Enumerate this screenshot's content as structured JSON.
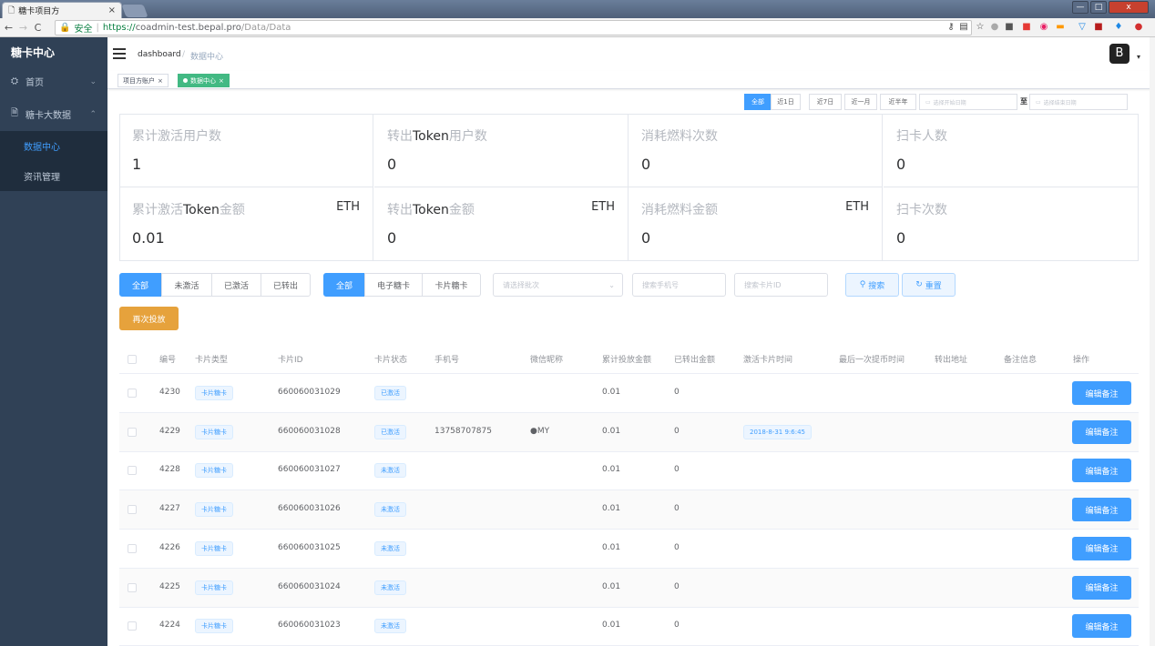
{
  "browser": {
    "tab_title": "糖卡项目方",
    "tab_close": "×",
    "secure_label": "安全",
    "url_proto": "https://",
    "url_host": "coadmin-test.bepal.pro",
    "url_path": "/Data/Data",
    "window_min": "—",
    "window_max": "□",
    "window_close": "x"
  },
  "sidebar": {
    "logo": "糖卡中心",
    "items": [
      {
        "label": "首页",
        "icon": "dashboard-icon"
      },
      {
        "label": "糖卡大数据",
        "icon": "document-icon"
      }
    ],
    "sub_items": [
      {
        "label": "数据中心"
      },
      {
        "label": "资讯管理"
      }
    ]
  },
  "header": {
    "breadcrumb_home": "dashboard",
    "breadcrumb_sep": "/",
    "breadcrumb_current": "数据中心",
    "avatar_text": "B"
  },
  "tagsview": [
    {
      "label": "项目方账户",
      "close": "×"
    },
    {
      "label": "数据中心",
      "close": "×"
    }
  ],
  "date_filter": {
    "ranges": [
      "全部",
      "近1日",
      "近7日",
      "近一月",
      "近半年"
    ],
    "start_placeholder": "选择开始日期",
    "to_label": "至",
    "end_placeholder": "选择结束日期"
  },
  "stats": [
    {
      "label_pre": "累计激活用户数",
      "label_bold": "",
      "label_post": "",
      "unit": "",
      "value": "1"
    },
    {
      "label_pre": "转出",
      "label_bold": "Token",
      "label_post": "用户数",
      "unit": "",
      "value": "0"
    },
    {
      "label_pre": "消耗燃料次数",
      "label_bold": "",
      "label_post": "",
      "unit": "",
      "value": "0"
    },
    {
      "label_pre": "扫卡人数",
      "label_bold": "",
      "label_post": "",
      "unit": "",
      "value": "0"
    },
    {
      "label_pre": "累计激活",
      "label_bold": "Token",
      "label_post": "金额",
      "unit": "ETH",
      "value": "0.01"
    },
    {
      "label_pre": "转出",
      "label_bold": "Token",
      "label_post": "金额",
      "unit": "ETH",
      "value": "0"
    },
    {
      "label_pre": "消耗燃料金额",
      "label_bold": "",
      "label_post": "",
      "unit": "ETH",
      "value": "0"
    },
    {
      "label_pre": "扫卡次数",
      "label_bold": "",
      "label_post": "",
      "unit": "",
      "value": "0"
    }
  ],
  "filters": {
    "status": [
      "全部",
      "未激活",
      "已激活",
      "已转出"
    ],
    "card_type": [
      "全部",
      "电子糖卡",
      "卡片糖卡"
    ],
    "batch_placeholder": "请选择批次",
    "phone_placeholder": "搜索手机号",
    "card_placeholder": "搜索卡片ID",
    "search_label": "搜索",
    "reset_label": "重置",
    "redeploy_label": "再次投放"
  },
  "table": {
    "headers": [
      "编号",
      "卡片类型",
      "卡片ID",
      "卡片状态",
      "手机号",
      "微信昵称",
      "累计投放金额",
      "已转出金额",
      "激活卡片时间",
      "最后一次提币时间",
      "转出地址",
      "备注信息",
      "操作"
    ],
    "edit_label": "编辑备注",
    "rows": [
      {
        "id": "4230",
        "type": "卡片糖卡",
        "card_id": "660060031029",
        "status": "已激活",
        "phone": "",
        "wechat": "",
        "deployed": "0.01",
        "transferred": "0",
        "activated_at": ""
      },
      {
        "id": "4229",
        "type": "卡片糖卡",
        "card_id": "660060031028",
        "status": "已激活",
        "phone": "13758707875",
        "wechat": "●MY",
        "deployed": "0.01",
        "transferred": "0",
        "activated_at": "2018-8-31 9:6:45"
      },
      {
        "id": "4228",
        "type": "卡片糖卡",
        "card_id": "660060031027",
        "status": "未激活",
        "phone": "",
        "wechat": "",
        "deployed": "0.01",
        "transferred": "0",
        "activated_at": ""
      },
      {
        "id": "4227",
        "type": "卡片糖卡",
        "card_id": "660060031026",
        "status": "未激活",
        "phone": "",
        "wechat": "",
        "deployed": "0.01",
        "transferred": "0",
        "activated_at": ""
      },
      {
        "id": "4226",
        "type": "卡片糖卡",
        "card_id": "660060031025",
        "status": "未激活",
        "phone": "",
        "wechat": "",
        "deployed": "0.01",
        "transferred": "0",
        "activated_at": ""
      },
      {
        "id": "4225",
        "type": "卡片糖卡",
        "card_id": "660060031024",
        "status": "未激活",
        "phone": "",
        "wechat": "",
        "deployed": "0.01",
        "transferred": "0",
        "activated_at": ""
      },
      {
        "id": "4224",
        "type": "卡片糖卡",
        "card_id": "660060031023",
        "status": "未激活",
        "phone": "",
        "wechat": "",
        "deployed": "0.01",
        "transferred": "0",
        "activated_at": ""
      }
    ]
  },
  "colors": {
    "primary": "#409eff",
    "sidebar": "#304156",
    "success": "#42b983",
    "warning": "#e6a23c"
  }
}
